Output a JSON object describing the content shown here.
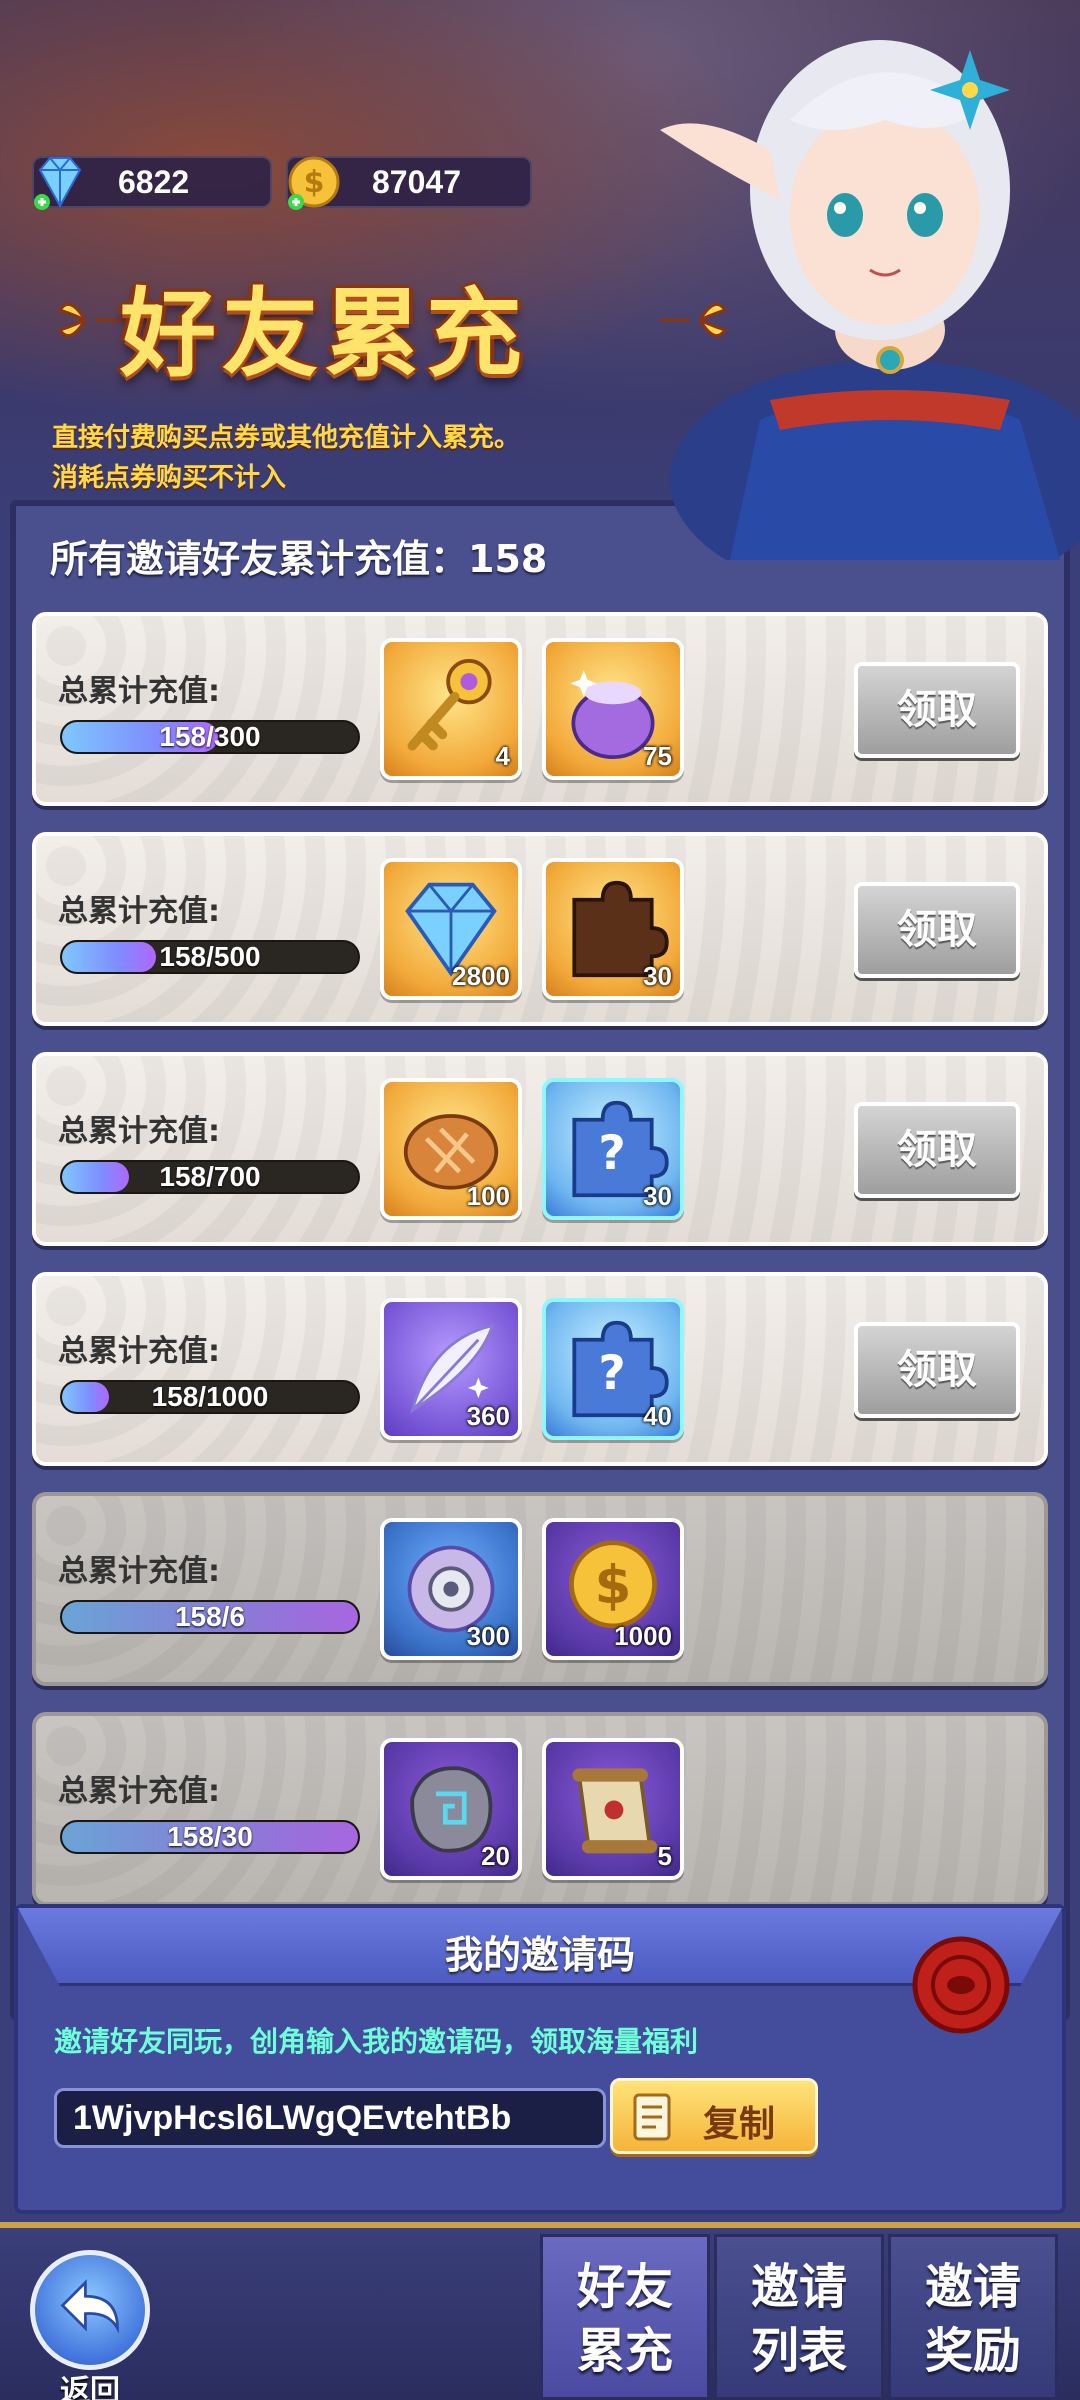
{
  "currencies": {
    "diamonds": "6822",
    "gold": "87047"
  },
  "header": {
    "title": "好友累充",
    "desc_line1": "直接付费购买点券或其他充值计入累充。",
    "desc_line2": "消耗点券购买不计入"
  },
  "total": {
    "label": "所有邀请好友累计充值：",
    "value": "158"
  },
  "rows": [
    {
      "label": "总累计充值:",
      "progress_text": "158/300",
      "progress": 0.527,
      "items": [
        {
          "icon": "key-icon",
          "count": "4"
        },
        {
          "icon": "pouch-icon",
          "count": "75"
        }
      ],
      "button": "领取",
      "locked": false
    },
    {
      "label": "总累计充值:",
      "progress_text": "158/500",
      "progress": 0.316,
      "items": [
        {
          "icon": "diamond-icon",
          "count": "2800"
        },
        {
          "icon": "puzzle-piece-icon",
          "count": "30"
        }
      ],
      "button": "领取",
      "locked": false
    },
    {
      "label": "总累计充值:",
      "progress_text": "158/700",
      "progress": 0.226,
      "items": [
        {
          "icon": "bread-icon",
          "count": "100"
        },
        {
          "icon": "mystery-puzzle-icon",
          "count": "30"
        }
      ],
      "button": "领取",
      "locked": false
    },
    {
      "label": "总累计充值:",
      "progress_text": "158/1000",
      "progress": 0.158,
      "items": [
        {
          "icon": "feather-icon",
          "count": "360"
        },
        {
          "icon": "mystery-puzzle-icon",
          "count": "40"
        }
      ],
      "button": "领取",
      "locked": false
    },
    {
      "label": "总累计充值:",
      "progress_text": "158/6",
      "progress": 1.0,
      "items": [
        {
          "icon": "saw-blade-orb-icon",
          "count": "300"
        },
        {
          "icon": "gold-coin-icon",
          "count": "1000"
        }
      ],
      "button": "",
      "locked": true
    },
    {
      "label": "总累计充值:",
      "progress_text": "158/30",
      "progress": 1.0,
      "items": [
        {
          "icon": "rune-stone-icon",
          "count": "20"
        },
        {
          "icon": "scroll-icon",
          "count": "5"
        }
      ],
      "button": "",
      "locked": true
    }
  ],
  "invite": {
    "title": "我的邀请码",
    "desc": "邀请好友同玩，创角输入我的邀请码，领取海量福利",
    "code": "1WjvpHcsl6LWgQEvtehtBb",
    "copy_label": "复制"
  },
  "nav": {
    "back_label": "返回",
    "tabs": [
      {
        "line1": "好友",
        "line2": "累充",
        "active": true
      },
      {
        "line1": "邀请",
        "line2": "列表",
        "active": false
      },
      {
        "line1": "邀请",
        "line2": "奖励",
        "active": false
      }
    ]
  },
  "colors": {
    "title_yellow": "#ffe46b",
    "desc_yellow": "#ffd84a",
    "invite_text": "#6effd8",
    "panel_bg": "#4a4f8e"
  }
}
